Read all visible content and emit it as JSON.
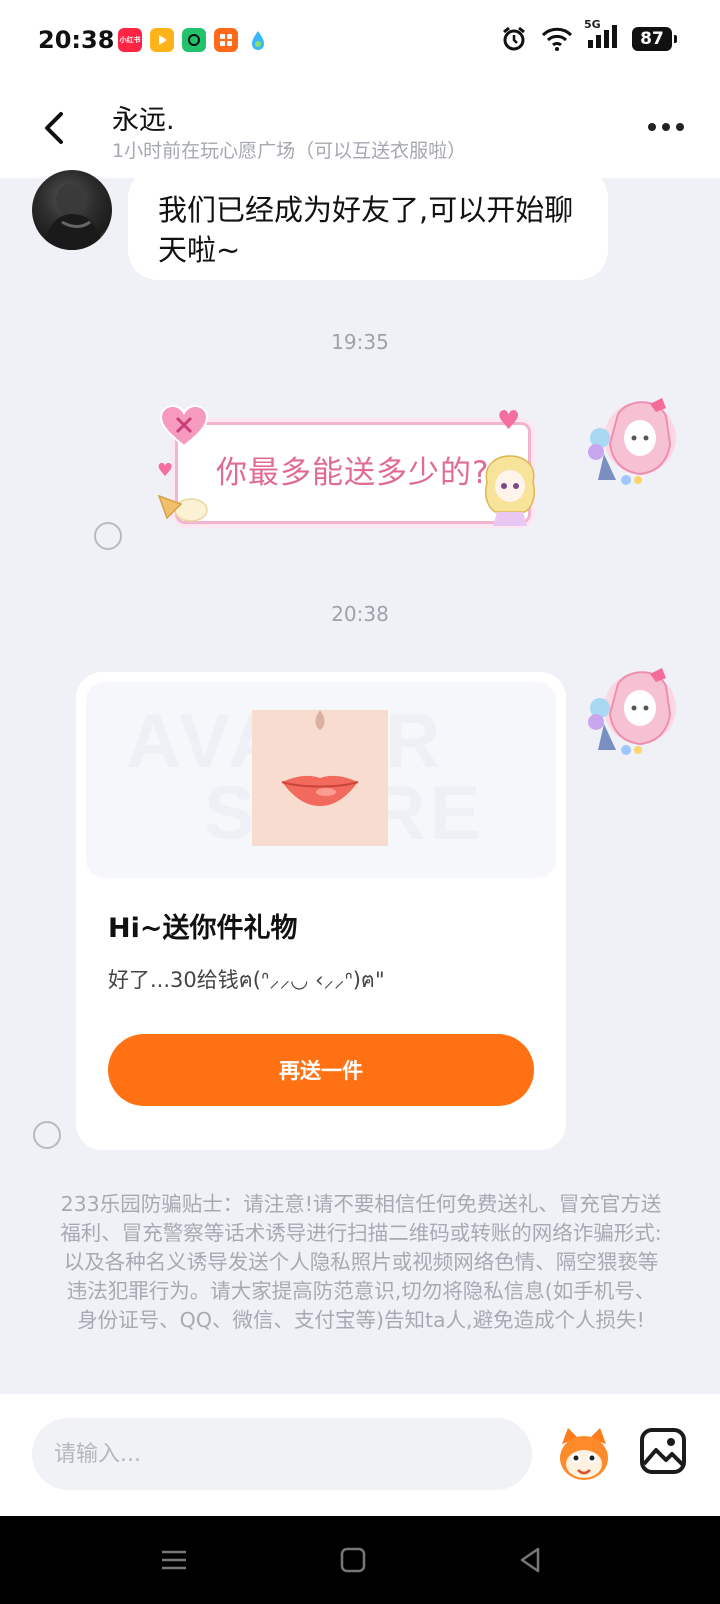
{
  "status_bar": {
    "time": "20:38",
    "apps": [
      {
        "name": "xiaohongshu-app-icon",
        "color": "#ff2442",
        "label": "小红书"
      },
      {
        "name": "video-app-icon",
        "color": "#ffb31a",
        "label": ""
      },
      {
        "name": "chat-app-icon",
        "color": "#22c36b",
        "label": ""
      },
      {
        "name": "grid-app-icon",
        "color": "#ff6a1a",
        "label": ""
      },
      {
        "name": "drop-app-icon",
        "color": "#38b6ff",
        "label": ""
      }
    ],
    "network": "5G",
    "battery": "87"
  },
  "header": {
    "name": "永远.",
    "subtitle": "1小时前在玩心愿广场（可以互送衣服啦）"
  },
  "messages": {
    "system_friend": "我们已经成为好友了,可以开始聊天啦~",
    "time_1": "19:35",
    "sticker_text": "你最多能送多少的?",
    "time_2": "20:38",
    "gift": {
      "title": "Hi~送你件礼物",
      "description": "好了...30给钱ฅ(ᐢ⸝⸝◡ ‹⸝⸝ᐢ)ฅ\"",
      "button_label": "再送一件",
      "watermark_1": "AVATAR",
      "watermark_2": "STORE"
    }
  },
  "warning_text": "233乐园防骗贴士：请注意!请不要相信任何免费送礼、冒充官方送福利、冒充警察等话术诱导进行扫描二维码或转账的网络诈骗形式:以及各种名义诱导发送个人隐私照片或视频网络色情、隔空猥亵等违法犯罪行为。请大家提高防范意识,切勿将隐私信息(如手机号、身份证号、QQ、微信、支付宝等)告知ta人,避免造成个人损失!",
  "input": {
    "placeholder": "请输入..."
  },
  "colors": {
    "accent": "#ff7113",
    "background": "#eff1f7",
    "sticker_pink": "#e06b95"
  }
}
